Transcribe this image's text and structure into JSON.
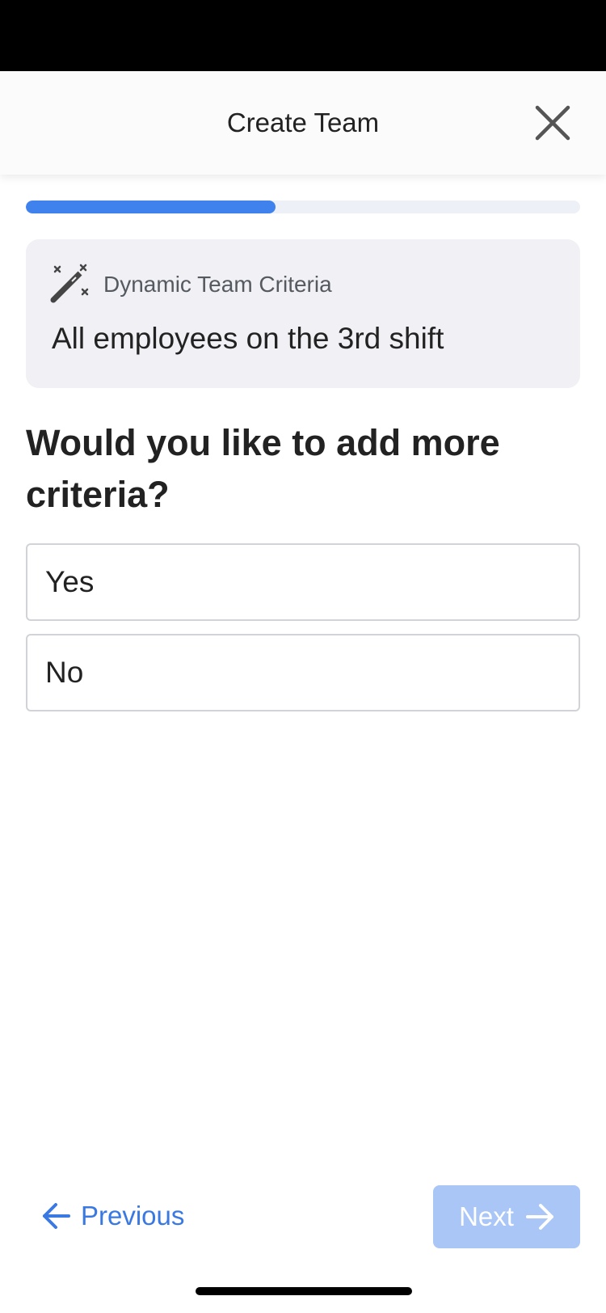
{
  "header": {
    "title": "Create Team",
    "close_icon": "close-icon"
  },
  "progress": {
    "fraction": 0.45,
    "fill_color": "#3f82ee",
    "track_color": "#eef0f8"
  },
  "criteria_card": {
    "icon": "magic-wand-icon",
    "label": "Dynamic Team Criteria",
    "value": "All employees on the 3rd shift"
  },
  "question": {
    "text": "Would you like to add more criteria?"
  },
  "options": [
    {
      "label": "Yes"
    },
    {
      "label": "No"
    }
  ],
  "footer": {
    "previous_label": "Previous",
    "previous_icon": "arrow-left-icon",
    "next_label": "Next",
    "next_icon": "arrow-right-icon",
    "accent_color": "#3a78e2",
    "next_disabled_color": "#a9c6f7"
  }
}
